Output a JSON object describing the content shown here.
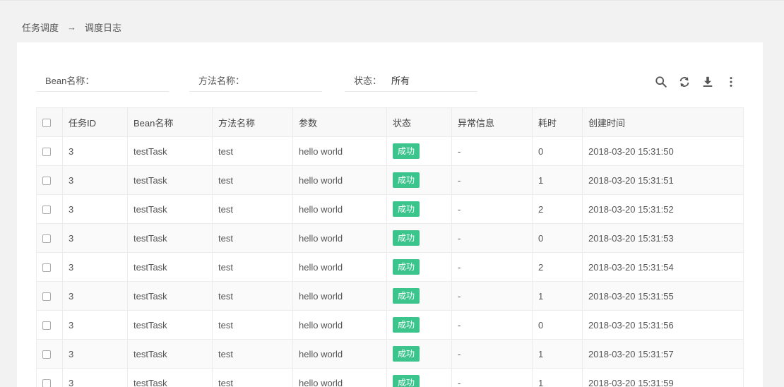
{
  "breadcrumb": {
    "parent": "任务调度",
    "arrow": "→",
    "current": "调度日志"
  },
  "filters": {
    "bean_label": "Bean名称：",
    "bean_value": "",
    "method_label": "方法名称：",
    "method_value": "",
    "status_label": "状态：",
    "status_value": "所有"
  },
  "toolbar": [
    "search-icon",
    "refresh-icon",
    "download-icon",
    "more-vertical-icon"
  ],
  "table": {
    "columns": [
      "任务ID",
      "Bean名称",
      "方法名称",
      "参数",
      "状态",
      "异常信息",
      "耗时",
      "创建时间"
    ],
    "rows": [
      {
        "id": "3",
        "bean": "testTask",
        "method": "test",
        "params": "hello world",
        "status": "成功",
        "error": "-",
        "time": "0",
        "created": "2018-03-20 15:31:50"
      },
      {
        "id": "3",
        "bean": "testTask",
        "method": "test",
        "params": "hello world",
        "status": "成功",
        "error": "-",
        "time": "1",
        "created": "2018-03-20 15:31:51"
      },
      {
        "id": "3",
        "bean": "testTask",
        "method": "test",
        "params": "hello world",
        "status": "成功",
        "error": "-",
        "time": "2",
        "created": "2018-03-20 15:31:52"
      },
      {
        "id": "3",
        "bean": "testTask",
        "method": "test",
        "params": "hello world",
        "status": "成功",
        "error": "-",
        "time": "0",
        "created": "2018-03-20 15:31:53"
      },
      {
        "id": "3",
        "bean": "testTask",
        "method": "test",
        "params": "hello world",
        "status": "成功",
        "error": "-",
        "time": "2",
        "created": "2018-03-20 15:31:54"
      },
      {
        "id": "3",
        "bean": "testTask",
        "method": "test",
        "params": "hello world",
        "status": "成功",
        "error": "-",
        "time": "1",
        "created": "2018-03-20 15:31:55"
      },
      {
        "id": "3",
        "bean": "testTask",
        "method": "test",
        "params": "hello world",
        "status": "成功",
        "error": "-",
        "time": "0",
        "created": "2018-03-20 15:31:56"
      },
      {
        "id": "3",
        "bean": "testTask",
        "method": "test",
        "params": "hello world",
        "status": "成功",
        "error": "-",
        "time": "1",
        "created": "2018-03-20 15:31:57"
      },
      {
        "id": "3",
        "bean": "testTask",
        "method": "test",
        "params": "hello world",
        "status": "成功",
        "error": "-",
        "time": "1",
        "created": "2018-03-20 15:31:59"
      }
    ]
  },
  "colors": {
    "success": "#3bc58d",
    "page_bg": "#f2f2f2"
  }
}
